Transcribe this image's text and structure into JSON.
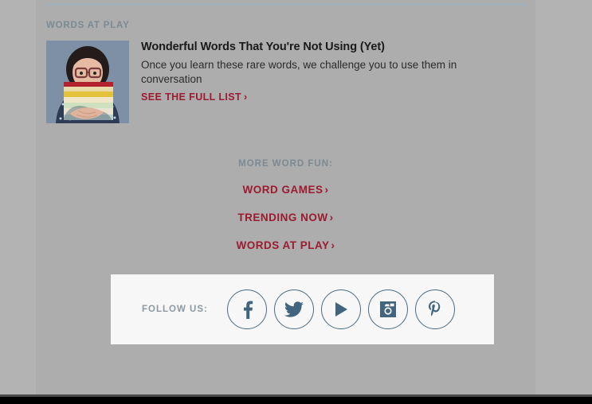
{
  "colors": {
    "page_background": "#b3b3b3",
    "content_background": "#adadad",
    "divider": "#9fb0ba",
    "kicker_text": "#7b8a93",
    "link_red": "#9b1b30",
    "social_blue": "#41647f",
    "follow_bar_background": "#f7f7f7"
  },
  "section": {
    "kicker": "WORDS AT PLAY"
  },
  "article": {
    "thumbnail_alt": "Woman with glasses holding a stack of colorful books",
    "title": "Wonderful Words That You're Not Using (Yet)",
    "dek": "Once you learn these rare words, we challenge you to use them in conversation",
    "cta_label": "SEE THE FULL LIST",
    "cta_chevron": "›"
  },
  "more_word_fun": {
    "label": "MORE WORD FUN:",
    "links": [
      {
        "label": "WORD GAMES",
        "chevron": "›"
      },
      {
        "label": "TRENDING NOW",
        "chevron": "›"
      },
      {
        "label": "WORDS AT PLAY",
        "chevron": "›"
      }
    ]
  },
  "follow": {
    "label": "FOLLOW US:",
    "icons": [
      {
        "name": "facebook-icon",
        "title": "Facebook"
      },
      {
        "name": "twitter-icon",
        "title": "Twitter"
      },
      {
        "name": "youtube-play-icon",
        "title": "YouTube"
      },
      {
        "name": "instagram-icon",
        "title": "Instagram"
      },
      {
        "name": "pinterest-icon",
        "title": "Pinterest"
      }
    ]
  }
}
